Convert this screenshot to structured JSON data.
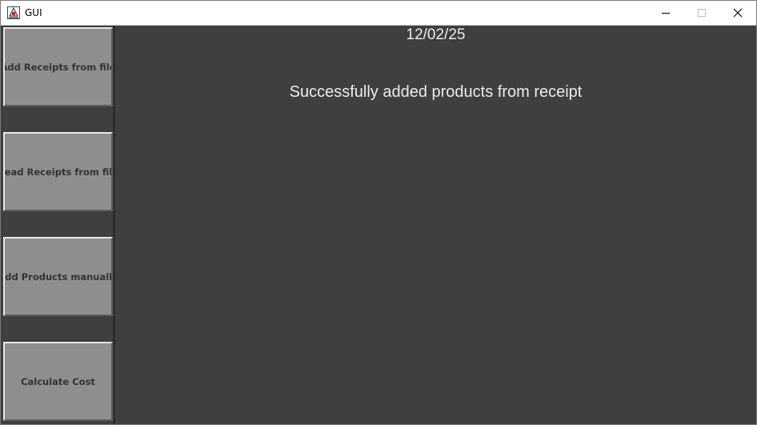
{
  "window": {
    "title": "GUI",
    "app_icon": "java-app-icon",
    "controls": {
      "minimize_icon": "minimize-icon",
      "maximize_icon": "maximize-icon",
      "close_icon": "close-icon"
    }
  },
  "sidebar": {
    "buttons": [
      {
        "label": "Add Receipts from file"
      },
      {
        "label": "Read Receipts from file"
      },
      {
        "label": "Add Products manually"
      },
      {
        "label": "Calculate Cost"
      }
    ]
  },
  "main": {
    "date": "12/02/25",
    "status_message": "Successfully added products from receipt"
  },
  "colors": {
    "background": "#3f3f3f",
    "button_face": "#8e8e8e",
    "button_text": "#333333",
    "main_text": "#ececec"
  }
}
